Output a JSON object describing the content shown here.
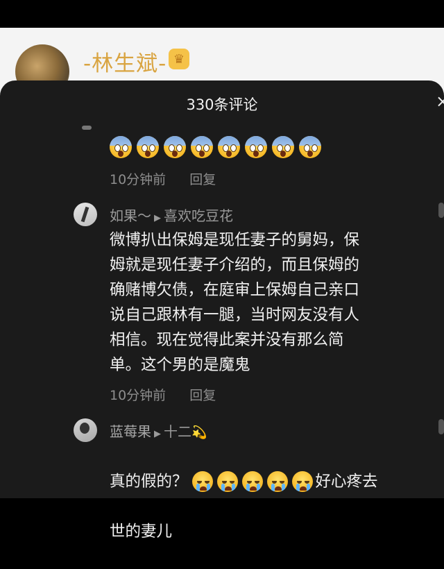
{
  "background_post": {
    "author": "-林生斌-"
  },
  "sheet": {
    "title": "330条评论",
    "close_icon": "×"
  },
  "comments": [
    {
      "emoji_count": 8,
      "emoji_kind": "face-screaming-in-fear",
      "time": "10分钟前",
      "reply": "回复"
    },
    {
      "user": "如果～",
      "reply_to": "喜欢吃豆花",
      "text": "微博扒出保姆是现任妻子的舅妈，保\n姆就是现任妻子介绍的，而且保姆的\n确赌博欠债，在庭审上保姆自己亲口\n说自己跟林有一腿，当时网友没有人\n相信。现在觉得此案并没有那么简\n单。这个男的是魔鬼",
      "time": "10分钟前",
      "reply": "回复"
    },
    {
      "user": "蓝莓果",
      "reply_to": "十二",
      "text_before": "真的假的？",
      "emoji_count": 5,
      "emoji_kind": "loudly-crying-face",
      "text_after": "好心疼去",
      "text_line2": "世的妻儿"
    }
  ]
}
